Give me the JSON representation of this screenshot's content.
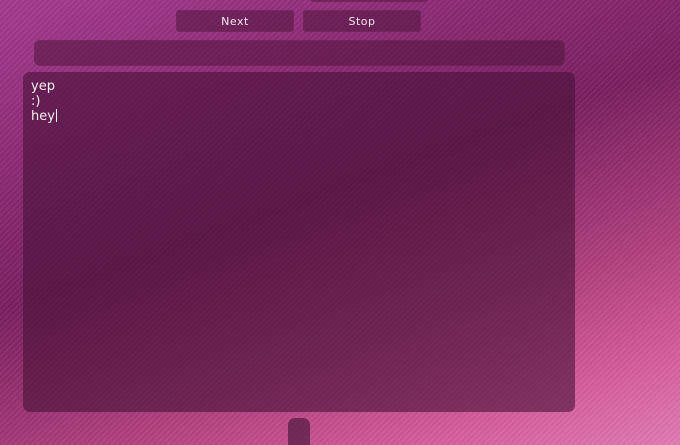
{
  "toolbar": {
    "next_label": "Next",
    "stop_label": "Stop"
  },
  "input": {
    "value": ""
  },
  "chat": {
    "lines": [
      "yep",
      ":)",
      "hey"
    ]
  }
}
